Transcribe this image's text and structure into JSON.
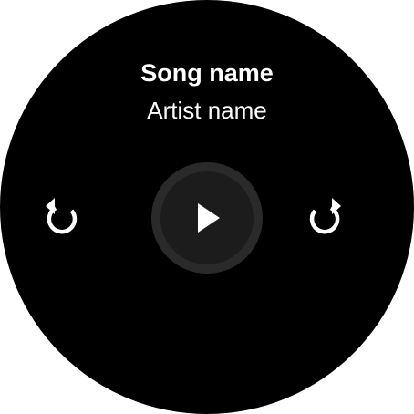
{
  "player": {
    "song_name": "Song name",
    "artist_name": "Artist name",
    "icons": {
      "back": "replay-icon",
      "play": "play-icon",
      "forward": "forward-icon"
    },
    "colors": {
      "background": "#000000",
      "text": "#ffffff",
      "play_ring": "#2a2a2a"
    }
  }
}
